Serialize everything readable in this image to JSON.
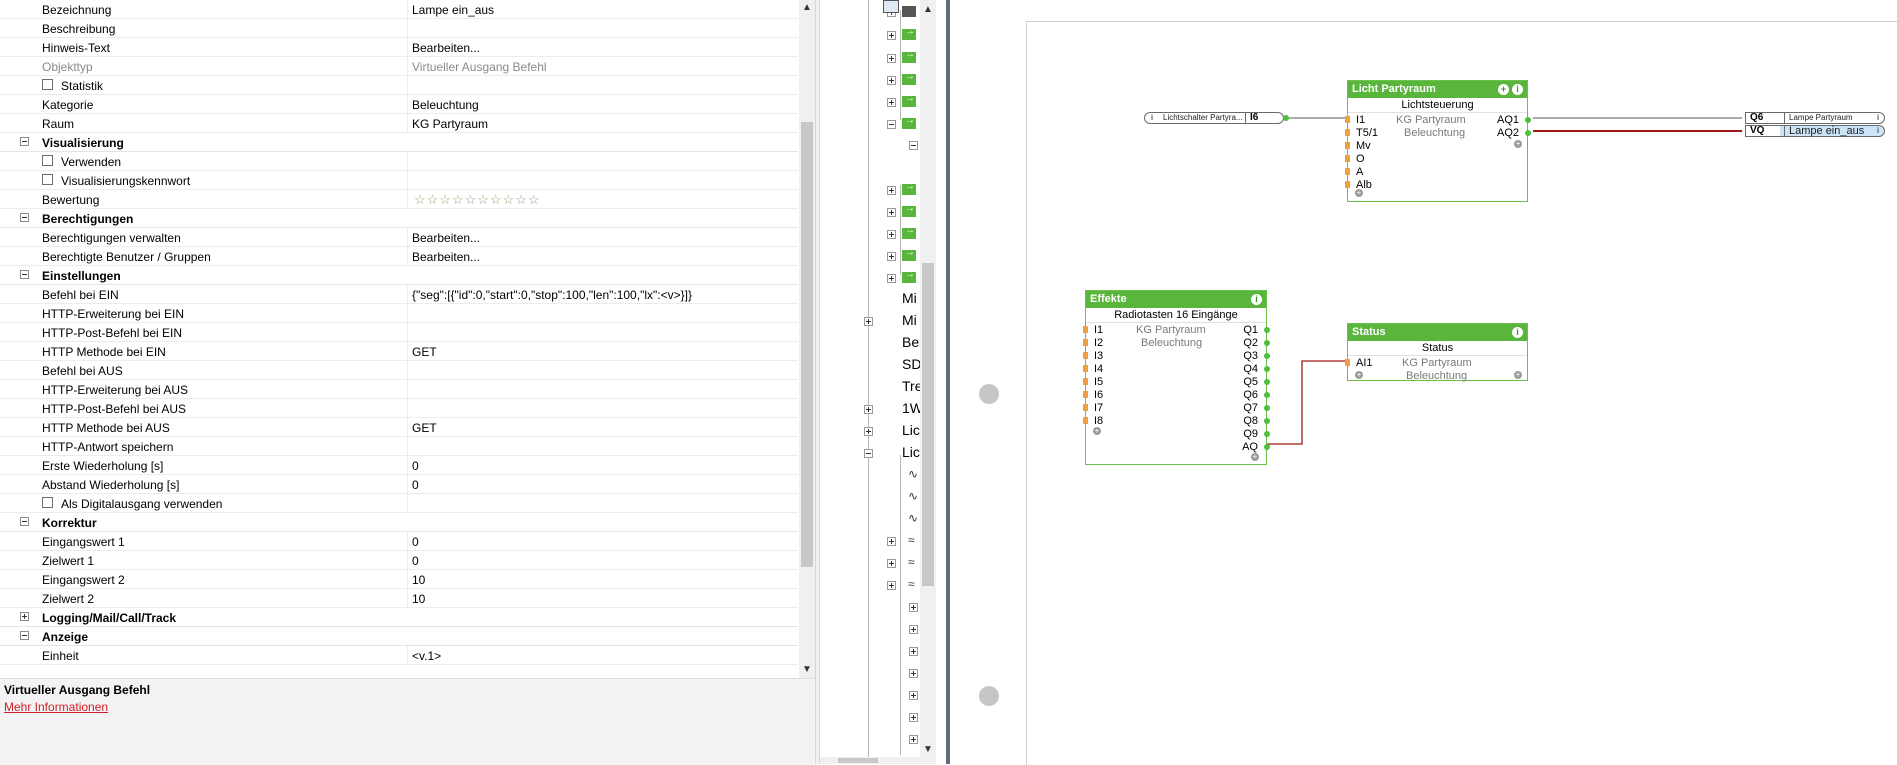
{
  "properties": {
    "rows": [
      {
        "name": "Bezeichnung",
        "value": "Lampe ein_aus"
      },
      {
        "name": "Beschreibung",
        "value": ""
      },
      {
        "name": "Hinweis-Text",
        "value": "Bearbeiten..."
      },
      {
        "name": "Objekttyp",
        "value": "Virtueller Ausgang Befehl"
      },
      {
        "name": "Statistik",
        "value": ""
      },
      {
        "name": "Kategorie",
        "value": "Beleuchtung"
      },
      {
        "name": "Raum",
        "value": "KG Partyraum"
      },
      {
        "name": "Visualisierung",
        "value": ""
      },
      {
        "name": "Verwenden",
        "value": ""
      },
      {
        "name": "Visualisierungskennwort",
        "value": ""
      },
      {
        "name": "Bewertung",
        "value": "☆☆☆☆☆☆☆☆☆☆"
      },
      {
        "name": "Berechtigungen",
        "value": ""
      },
      {
        "name": "Berechtigungen verwalten",
        "value": "Bearbeiten..."
      },
      {
        "name": "Berechtigte Benutzer / Gruppen",
        "value": "Bearbeiten..."
      },
      {
        "name": "Einstellungen",
        "value": ""
      },
      {
        "name": "Befehl bei EIN",
        "value": "{\"seg\":[{\"id\":0,\"start\":0,\"stop\":100,\"len\":100,\"lx\":<v>}]}"
      },
      {
        "name": "HTTP-Erweiterung bei EIN",
        "value": ""
      },
      {
        "name": "HTTP-Post-Befehl bei EIN",
        "value": ""
      },
      {
        "name": "HTTP Methode bei EIN",
        "value": "GET"
      },
      {
        "name": "Befehl bei AUS",
        "value": ""
      },
      {
        "name": "HTTP-Erweiterung bei AUS",
        "value": ""
      },
      {
        "name": "HTTP-Post-Befehl bei AUS",
        "value": ""
      },
      {
        "name": "HTTP Methode bei AUS",
        "value": "GET"
      },
      {
        "name": "HTTP-Antwort speichern",
        "value": ""
      },
      {
        "name": "Erste Wiederholung [s]",
        "value": "0"
      },
      {
        "name": "Abstand Wiederholung [s]",
        "value": "0"
      },
      {
        "name": "Als Digitalausgang verwenden",
        "value": ""
      },
      {
        "name": "Korrektur",
        "value": ""
      },
      {
        "name": "Eingangswert 1",
        "value": "0"
      },
      {
        "name": "Zielwert 1",
        "value": "0"
      },
      {
        "name": "Eingangswert 2",
        "value": "10"
      },
      {
        "name": "Zielwert 2",
        "value": "10"
      },
      {
        "name": "Logging/Mail/Call/Track",
        "value": ""
      },
      {
        "name": "Anzeige",
        "value": ""
      },
      {
        "name": "Einheit",
        "value": "<v.1>"
      }
    ]
  },
  "description": {
    "title": "Virtueller Ausgang Befehl",
    "link": "Mehr Informationen"
  },
  "tree": {
    "labels": [
      "Mi",
      "Mi",
      "Bel",
      "SD",
      "Tre",
      "1W",
      "Lic",
      "Lic"
    ]
  },
  "canvas": {
    "input_connector": {
      "label": "Lichtschalter Partyra...",
      "pin": "I6"
    },
    "output_q6": {
      "pin": "Q6",
      "label": "Lampe Partyraum"
    },
    "output_vq": {
      "pin": "VQ",
      "label": "Lampe ein_aus"
    },
    "licht": {
      "title": "Licht Partyraum",
      "subtitle": "Lichtsteuerung",
      "inputs": [
        "I1",
        "T5/1",
        "Mv",
        "O",
        "A",
        "Alb"
      ],
      "outputs": [
        "AQ1",
        "AQ2"
      ],
      "room": "KG Partyraum",
      "category": "Beleuchtung"
    },
    "effekte": {
      "title": "Effekte",
      "subtitle": "Radiotasten 16 Eingänge",
      "inputs": [
        "I1",
        "I2",
        "I3",
        "I4",
        "I5",
        "I6",
        "I7",
        "I8"
      ],
      "outputs": [
        "Q1",
        "Q2",
        "Q3",
        "Q4",
        "Q5",
        "Q6",
        "Q7",
        "Q8",
        "Q9",
        "AQ"
      ],
      "room": "KG Partyraum",
      "category": "Beleuchtung"
    },
    "status": {
      "title": "Status",
      "subtitle": "Status",
      "inputs": [
        "AI1"
      ],
      "room": "KG Partyraum",
      "category": "Beleuchtung"
    }
  },
  "colors": {
    "block_green": "#5ab53c",
    "wire_red": "#a01818",
    "link_red": "#d0202a",
    "selected_blue": "#cce4f7"
  }
}
